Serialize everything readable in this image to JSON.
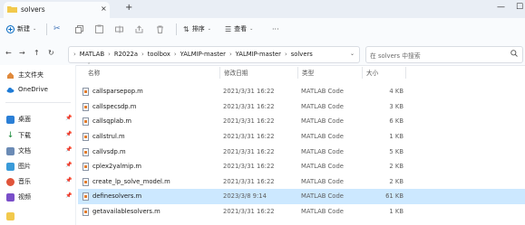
{
  "tab": {
    "title": "solvers",
    "close": "×",
    "new": "+"
  },
  "window": {
    "minimize": "—",
    "maximize": "☐"
  },
  "commands": {
    "new_label": "新建",
    "sort_label": "排序",
    "view_label": "查看",
    "more": "···"
  },
  "address": {
    "crumbs": [
      "MATLAB",
      "R2022a",
      "toolbox",
      "YALMIP-master",
      "YALMIP-master",
      "solvers"
    ],
    "separator": "›"
  },
  "search": {
    "placeholder": "在 solvers 中搜索"
  },
  "sidebar": {
    "items": [
      {
        "label": "主文件夹",
        "icon": "home-icon"
      },
      {
        "label": "OneDrive",
        "icon": "cloud-icon"
      },
      {
        "label": "桌面",
        "icon": "desktop-icon"
      },
      {
        "label": "下载",
        "icon": "download-icon"
      },
      {
        "label": "文档",
        "icon": "document-icon"
      },
      {
        "label": "图片",
        "icon": "picture-icon"
      },
      {
        "label": "音乐",
        "icon": "music-icon"
      },
      {
        "label": "视频",
        "icon": "video-icon"
      }
    ]
  },
  "columns": {
    "name": "名称",
    "date": "修改日期",
    "type": "类型",
    "size": "大小"
  },
  "files": [
    {
      "name": "callsparsepop.m",
      "date": "2021/3/31 16:22",
      "type": "MATLAB Code",
      "size": "4 KB"
    },
    {
      "name": "callspecsdp.m",
      "date": "2021/3/31 16:22",
      "type": "MATLAB Code",
      "size": "3 KB"
    },
    {
      "name": "callsqplab.m",
      "date": "2021/3/31 16:22",
      "type": "MATLAB Code",
      "size": "6 KB"
    },
    {
      "name": "callstrul.m",
      "date": "2021/3/31 16:22",
      "type": "MATLAB Code",
      "size": "1 KB"
    },
    {
      "name": "callvsdp.m",
      "date": "2021/3/31 16:22",
      "type": "MATLAB Code",
      "size": "5 KB"
    },
    {
      "name": "cplex2yalmip.m",
      "date": "2021/3/31 16:22",
      "type": "MATLAB Code",
      "size": "2 KB"
    },
    {
      "name": "create_lp_solve_model.m",
      "date": "2021/3/31 16:22",
      "type": "MATLAB Code",
      "size": "2 KB"
    },
    {
      "name": "definesolvers.m",
      "date": "2023/3/8 9:14",
      "type": "MATLAB Code",
      "size": "61 KB"
    },
    {
      "name": "getavailablesolvers.m",
      "date": "2021/3/31 16:22",
      "type": "MATLAB Code",
      "size": "1 KB"
    }
  ],
  "colors": {
    "selected_row": "#cce8ff",
    "accent": "#0067c0"
  }
}
